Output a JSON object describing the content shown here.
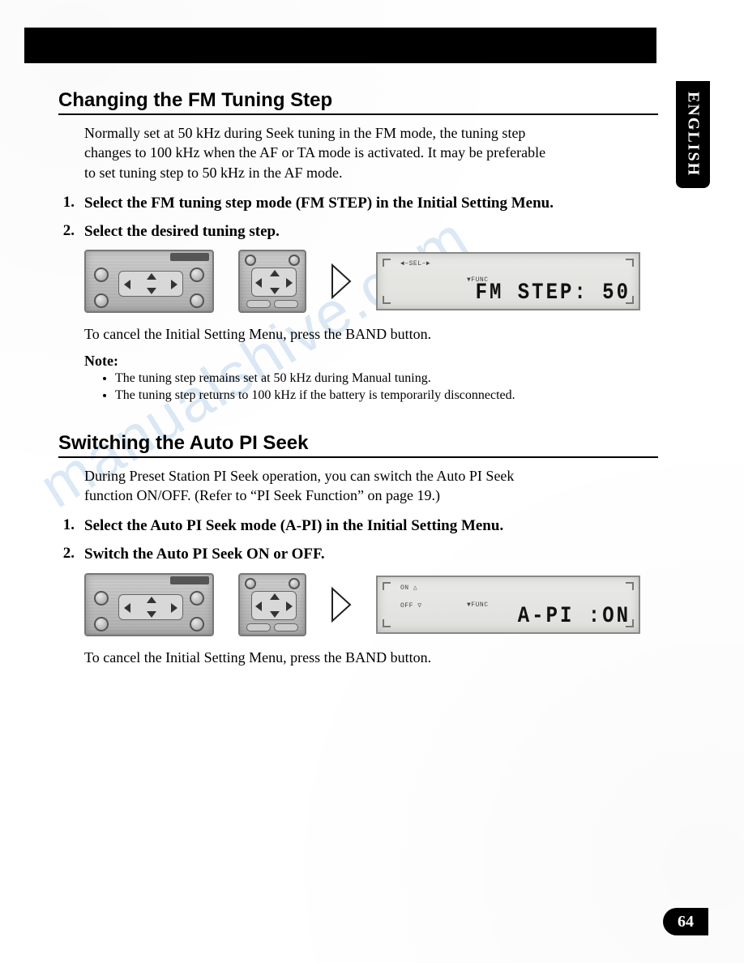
{
  "language_tab": "ENGLISH",
  "page_number": "64",
  "watermark": "manualshive.com",
  "section1": {
    "title": "Changing the FM Tuning Step",
    "intro": "Normally set at 50 kHz during Seek tuning in the FM mode, the tuning step changes to 100 kHz when the AF or TA mode is activated. It may be preferable to set tuning step to 50 kHz in the AF mode.",
    "steps": [
      "Select the FM tuning step mode (FM STEP) in the Initial Setting Menu.",
      "Select the desired tuning step."
    ],
    "display_small_sel": "◄–SEL–►",
    "display_small_func": "▼FUNC",
    "display_text": "FM STEP: 50",
    "cancel_text": "To cancel the Initial Setting Menu, press the BAND button.",
    "note_label": "Note:",
    "notes": [
      "The tuning step remains set at 50 kHz during Manual tuning.",
      "The tuning step returns to 100 kHz if the battery is temporarily disconnected."
    ]
  },
  "section2": {
    "title": "Switching the Auto PI Seek",
    "intro": "During Preset Station PI Seek operation, you can switch the Auto PI Seek function ON/OFF. (Refer to “PI Seek Function” on page 19.)",
    "steps": [
      "Select the Auto PI Seek mode (A-PI) in the Initial Setting Menu.",
      "Switch the Auto PI Seek ON or OFF."
    ],
    "display_small_on": "ON △",
    "display_small_off": "OFF ▽",
    "display_small_func": "▼FUNC",
    "display_text": "A-PI  :ON",
    "cancel_text": "To cancel the Initial Setting Menu, press the BAND button."
  },
  "icons": {
    "arrow_right": "▷",
    "dpad_up": "▲",
    "dpad_down": "▼",
    "dpad_left": "◄",
    "dpad_right": "►"
  }
}
